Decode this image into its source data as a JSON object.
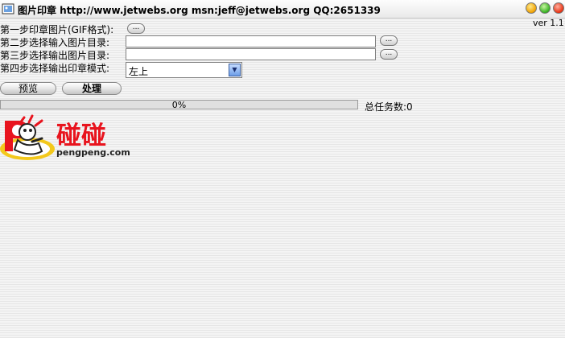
{
  "window": {
    "title": "图片印章 http://www.jetwebs.org  msn:jeff@jetwebs.org QQ:2651339",
    "version": "ver  1.1"
  },
  "steps": {
    "step1_label": "第一步印章图片(GIF格式):",
    "step2_label": "第二步选择输入图片目录:",
    "step3_label": "第三步选择输出图片目录:",
    "step4_label": "第四步选择输出印章模式:",
    "browse_label": "...",
    "input_dir_value": "",
    "output_dir_value": "",
    "stamp_mode_selected": "左上"
  },
  "actions": {
    "preview_label": "预览",
    "process_label": "处理"
  },
  "progress": {
    "percent_text": "0%",
    "value": 0,
    "total_tasks": "总任务数:0"
  },
  "logo": {
    "chinese": "碰碰",
    "url": "pengpeng.com"
  },
  "colors": {
    "logo_red": "#e8141e",
    "logo_yellow": "#f3c81c"
  }
}
